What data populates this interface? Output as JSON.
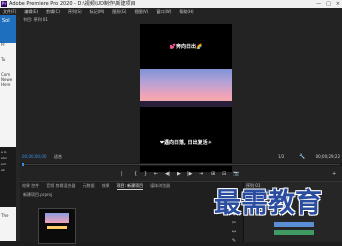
{
  "titlebar": {
    "app_title": "Adobe Premiere Pro 2020 - D:\\视频\\UD制作\\新建项目",
    "logo": "Pr",
    "min": "—",
    "max": "□",
    "close": "×"
  },
  "menu": [
    "文件(F)",
    "编辑(E)",
    "剪辑(C)",
    "序列(S)",
    "标记(M)",
    "图形(G)",
    "视图(V)",
    "窗口(W)",
    "帮助(H)"
  ],
  "browser": {
    "badge": "Sol",
    "lines": [
      "Pr",
      "Tu",
      "Com",
      "Newe",
      "Here"
    ],
    "dark_lines": [
      "a lo",
      "stor",
      "scri",
      "all"
    ],
    "bottom": "The"
  },
  "monitor": {
    "tab": "节目: 序列 01",
    "caption_top": "💕奔向日出🌈",
    "caption_bottom": "❤遇向日落, 日出复活☀",
    "timecode_left": "00;00;00;00",
    "fit": "适合",
    "quality": "1/2",
    "timecode_right": "00;00;29;22"
  },
  "controls": [
    "|",
    "{",
    "}",
    "⇤",
    "◀|",
    "▶",
    "|▶",
    "⇥",
    "⊞",
    "⊟",
    "📷"
  ],
  "panel_tabs": [
    {
      "label": "效果 控件",
      "active": false
    },
    {
      "label": "音频 剪辑混合器",
      "active": false
    },
    {
      "label": "元数据",
      "active": false
    },
    {
      "label": "效果",
      "active": false
    },
    {
      "label": "项目: 新建项目",
      "active": true
    },
    {
      "label": "媒体浏览器",
      "active": false
    }
  ],
  "project": {
    "title": "新建项目.prproj"
  },
  "tools": [
    "▶",
    "⇄",
    "◆",
    "✂",
    "↔",
    "✎"
  ],
  "sequence": {
    "title": "序列 01",
    "timecode": "00;00;00;00"
  },
  "watermark": "最需教育"
}
